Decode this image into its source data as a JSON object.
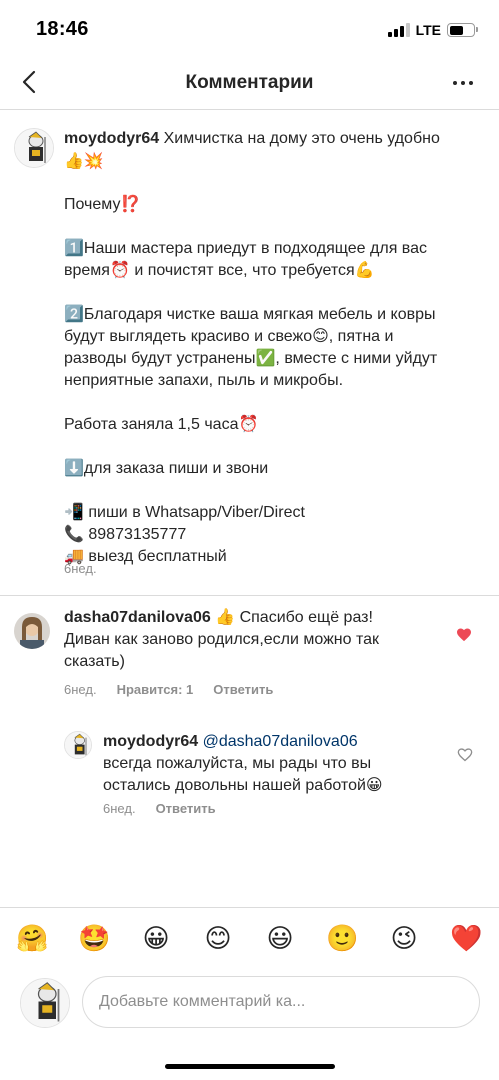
{
  "status_bar": {
    "time": "18:46",
    "network": "LTE",
    "battery_level": 0.6
  },
  "header": {
    "title": "Комментарии",
    "back_icon": "chevron-left-icon",
    "more_icon": "more-horizontal-icon"
  },
  "post": {
    "username": "moydodyr64",
    "lines": [
      "Химчистка на дому это очень удобно",
      "👍💥",
      "",
      "Почему⁉️",
      "",
      "1️⃣Наши мастера приедут в подходящее для вас",
      "время⏰ и почистят все, что требуется💪",
      "",
      "2️⃣Благодаря чистке ваша мягкая мебель и ковры",
      "будут выглядеть красиво и свежо😊, пятна и",
      "разводы будут устранены✅, вместе с ними уйдут",
      "неприятные запахи, пыль и микробы.",
      "",
      "Работа заняла 1,5 часа⏰",
      "",
      "⬇️для заказа пиши и звони",
      "",
      "📲 пиши в Whatsapp/Viber/Direct",
      "📞 89873135777",
      "🚚 выезд бесплатный"
    ],
    "time": "6нед."
  },
  "comment": {
    "username": "dasha07danilova06",
    "lines": [
      "👍 Спасибо ещё раз!",
      "Диван как заново родился,если можно так",
      "сказать)"
    ],
    "time": "6нед.",
    "likes": "Нравится: 1",
    "reply_label": "Ответить",
    "liked": true
  },
  "reply": {
    "username": "moydodyr64",
    "mention": "@dasha07danilova06",
    "lines": [
      "всегда пожалуйста, мы рады что вы",
      "остались довольны нашей работой😀"
    ],
    "time": "6нед.",
    "reply_label": "Ответить",
    "liked": false
  },
  "emoji_bar": [
    "🤗",
    "🤩",
    "😀",
    "😊",
    "😃",
    "🙂",
    "😉",
    "❤️"
  ],
  "composer": {
    "placeholder": "Добавьте комментарий ка..."
  },
  "colors": {
    "text": "#262626",
    "muted": "#8e8e8e",
    "heart_red": "#ed4956",
    "divider": "#dbdbdb",
    "mention": "#003569"
  }
}
